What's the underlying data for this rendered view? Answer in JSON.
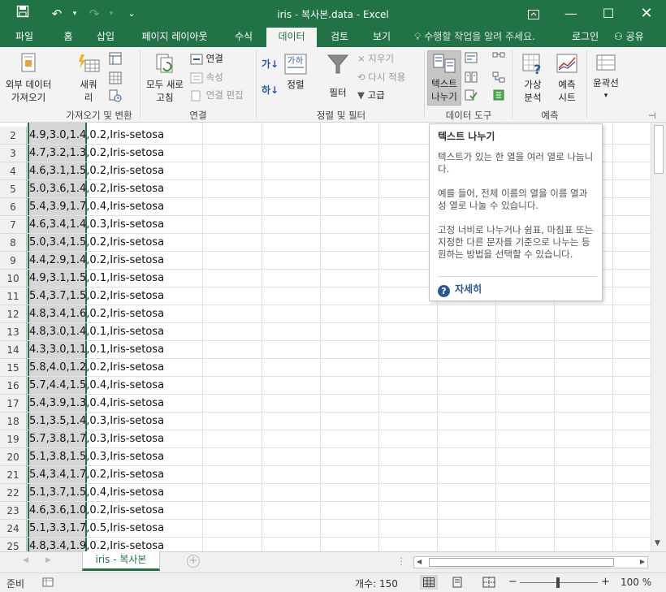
{
  "window": {
    "title": "iris - 복사본.data - Excel",
    "accent_color": "#217346"
  },
  "tabs": [
    "파일",
    "홈",
    "삽입",
    "페이지 레이아웃",
    "수식",
    "데이터",
    "검토",
    "보기"
  ],
  "active_tab": "데이터",
  "tell_me": "수행할 작업을 알려 주세요.",
  "login": "로그인",
  "share": "공유",
  "ribbon": {
    "get_external": "외부 데이터\n가져오기",
    "new_query": "새쿼\n리",
    "refresh_all": "모두 새로\n고침",
    "connections": "연결",
    "properties": "속성",
    "edit_links": "연결 편집",
    "sort": "정렬",
    "filter": "필터",
    "clear": "지우기",
    "reapply": "다시 적용",
    "advanced": "고급",
    "text_to_columns": "텍스트\n나누기",
    "what_if": "가상\n분석",
    "forecast_sheet": "예측\n시트",
    "outline": "윤곽선",
    "groups": {
      "get_transform": "가져오기 및 변환",
      "connections": "연결",
      "sort_filter": "정렬 및 필터",
      "data_tools": "데이터 도구",
      "forecast": "예측"
    }
  },
  "tooltip": {
    "title": "텍스트 나누기",
    "p1": "텍스트가 있는 한 열을 여러 열로 나눕니다.",
    "p2": "예를 들어, 전체 이름의 열을 이름 열과 성 열로 나눌 수 있습니다.",
    "p3": "고정 너비로 나누거나 쉼표, 마침표 또는 지정한 다른 문자를 기준으로 나누는 등 원하는 방법을 선택할 수 있습니다.",
    "more": "자세히"
  },
  "rows": [
    {
      "n": "2",
      "a": "4.9,3.0,1.4,0.2,Iris-setosa"
    },
    {
      "n": "3",
      "a": "4.7,3.2,1.3,0.2,Iris-setosa"
    },
    {
      "n": "4",
      "a": "4.6,3.1,1.5,0.2,Iris-setosa"
    },
    {
      "n": "5",
      "a": "5.0,3.6,1.4,0.2,Iris-setosa"
    },
    {
      "n": "6",
      "a": "5.4,3.9,1.7,0.4,Iris-setosa"
    },
    {
      "n": "7",
      "a": "4.6,3.4,1.4,0.3,Iris-setosa"
    },
    {
      "n": "8",
      "a": "5.0,3.4,1.5,0.2,Iris-setosa"
    },
    {
      "n": "9",
      "a": "4.4,2.9,1.4,0.2,Iris-setosa"
    },
    {
      "n": "10",
      "a": "4.9,3.1,1.5,0.1,Iris-setosa"
    },
    {
      "n": "11",
      "a": "5.4,3.7,1.5,0.2,Iris-setosa"
    },
    {
      "n": "12",
      "a": "4.8,3.4,1.6,0.2,Iris-setosa"
    },
    {
      "n": "13",
      "a": "4.8,3.0,1.4,0.1,Iris-setosa"
    },
    {
      "n": "14",
      "a": "4.3,3.0,1.1,0.1,Iris-setosa"
    },
    {
      "n": "15",
      "a": "5.8,4.0,1.2,0.2,Iris-setosa"
    },
    {
      "n": "16",
      "a": "5.7,4.4,1.5,0.4,Iris-setosa"
    },
    {
      "n": "17",
      "a": "5.4,3.9,1.3,0.4,Iris-setosa"
    },
    {
      "n": "18",
      "a": "5.1,3.5,1.4,0.3,Iris-setosa"
    },
    {
      "n": "19",
      "a": "5.7,3.8,1.7,0.3,Iris-setosa"
    },
    {
      "n": "20",
      "a": "5.1,3.8,1.5,0.3,Iris-setosa"
    },
    {
      "n": "21",
      "a": "5.4,3.4,1.7,0.2,Iris-setosa"
    },
    {
      "n": "22",
      "a": "5.1,3.7,1.5,0.4,Iris-setosa"
    },
    {
      "n": "23",
      "a": "4.6,3.6,1.0,0.2,Iris-setosa"
    },
    {
      "n": "24",
      "a": "5.1,3.3,1.7,0.5,Iris-setosa"
    },
    {
      "n": "25",
      "a": "4.8,3.4,1.9,0.2,Iris-setosa"
    }
  ],
  "sheet_tab": "iris - 복사본",
  "status": {
    "ready": "준비",
    "count": "개수: 150",
    "zoom": "100 %",
    "zoom_minus": "−",
    "zoom_plus": "+"
  }
}
